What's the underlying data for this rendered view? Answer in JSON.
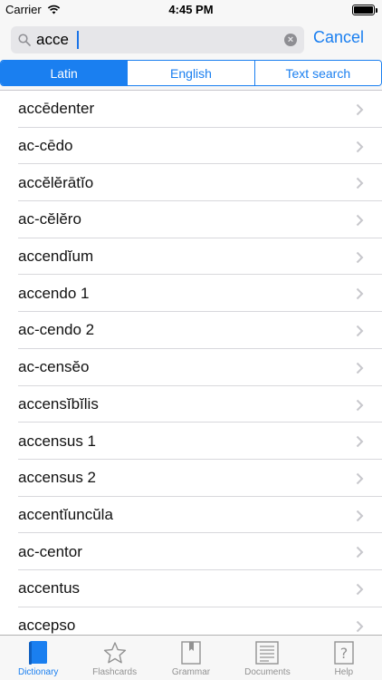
{
  "status_bar": {
    "carrier": "Carrier",
    "time": "4:45 PM"
  },
  "search": {
    "value": "acce",
    "cancel_label": "Cancel"
  },
  "segments": [
    {
      "label": "Latin",
      "active": true
    },
    {
      "label": "English",
      "active": false
    },
    {
      "label": "Text search",
      "active": false
    }
  ],
  "results": [
    "accēdenter",
    "ac-cēdo",
    "accĕlĕrātĭo",
    "ac-cĕlĕro",
    "accendĭum",
    "accendo 1",
    "ac-cendo 2",
    "ac-censĕo",
    "accensĭbĭlis",
    "accensus 1",
    "accensus 2",
    "accentĭuncŭla",
    "ac-centor",
    "accentus",
    "accepso"
  ],
  "tabs": [
    {
      "label": "Dictionary",
      "icon": "book-icon",
      "active": true
    },
    {
      "label": "Flashcards",
      "icon": "star-icon",
      "active": false
    },
    {
      "label": "Grammar",
      "icon": "bookmark-book-icon",
      "active": false
    },
    {
      "label": "Documents",
      "icon": "document-icon",
      "active": false
    },
    {
      "label": "Help",
      "icon": "question-icon",
      "active": false
    }
  ],
  "colors": {
    "accent": "#1a7ff0",
    "inactive_tab": "#929292",
    "bar_background": "#f7f7f7"
  }
}
